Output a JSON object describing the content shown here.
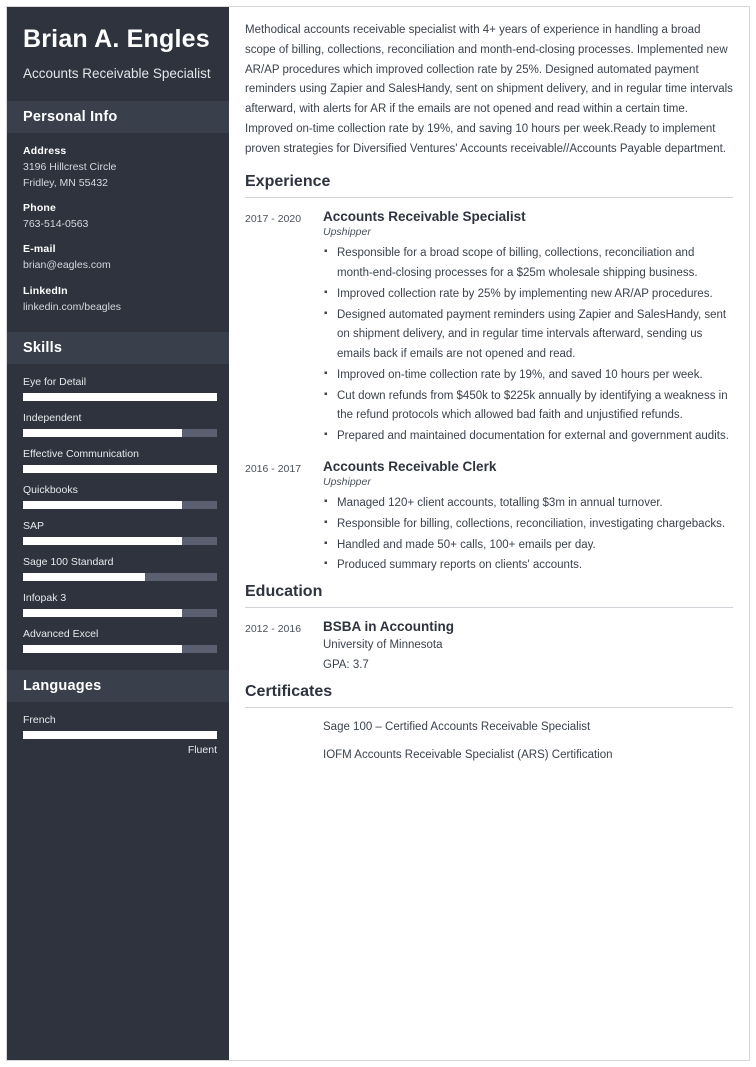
{
  "sidebar": {
    "name": "Brian A. Engles",
    "job_title": "Accounts Receivable Specialist",
    "personal_info_title": "Personal Info",
    "info": [
      {
        "label": "Address",
        "value": "3196 Hillcrest Circle",
        "value2": "Fridley, MN 55432"
      },
      {
        "label": "Phone",
        "value": "763-514-0563"
      },
      {
        "label": "E-mail",
        "value": "brian@eagles.com"
      },
      {
        "label": "LinkedIn",
        "value": "linkedin.com/beagles"
      }
    ],
    "skills_title": "Skills",
    "skills": [
      {
        "name": "Eye for Detail",
        "level": 100
      },
      {
        "name": "Independent",
        "level": 82
      },
      {
        "name": "Effective Communication",
        "level": 100
      },
      {
        "name": "Quickbooks",
        "level": 82
      },
      {
        "name": "SAP",
        "level": 82
      },
      {
        "name": "Sage 100 Standard",
        "level": 63
      },
      {
        "name": "Infopak 3",
        "level": 82
      },
      {
        "name": "Advanced Excel",
        "level": 82
      }
    ],
    "languages_title": "Languages",
    "languages": [
      {
        "name": "French",
        "level": 100,
        "proficiency": "Fluent"
      }
    ]
  },
  "main": {
    "summary": "Methodical accounts receivable specialist with 4+ years of experience in handling a broad scope of billing, collections, reconciliation and month-end-closing processes. Implemented new AR/AP procedures which improved collection rate by 25%. Designed automated payment reminders using Zapier and SalesHandy, sent on shipment delivery, and in regular time intervals afterward, with alerts for AR if the emails are not opened and read within a certain time. Improved on-time collection rate by 19%, and saving 10 hours per week.Ready to implement proven strategies for Diversified Ventures' Accounts receivable//Accounts Payable department.",
    "experience_title": "Experience",
    "experience": [
      {
        "date": "2017 - 2020",
        "title": "Accounts Receivable Specialist",
        "company": "Upshipper",
        "bullets": [
          "Responsible for a broad scope of billing, collections, reconciliation and month-end-closing processes for a $25m wholesale shipping business.",
          "Improved collection rate by 25% by implementing new AR/AP procedures.",
          "Designed automated payment reminders using Zapier and SalesHandy, sent on shipment delivery, and in regular time intervals afterward, sending us emails back if emails are not opened and read.",
          "Improved on-time collection rate by 19%, and saved 10 hours per week.",
          "Cut down refunds from $450k to $225k annually by identifying a weakness in the refund protocols which allowed bad faith and unjustified refunds.",
          "Prepared and maintained documentation for external and government audits."
        ]
      },
      {
        "date": "2016 - 2017",
        "title": "Accounts Receivable Clerk",
        "company": "Upshipper",
        "bullets": [
          "Managed 120+ client accounts, totalling $3m in annual turnover.",
          "Responsible for billing, collections, reconciliation, investigating chargebacks.",
          "Handled and made 50+ calls, 100+ emails per day.",
          "Produced summary reports on clients' accounts."
        ]
      }
    ],
    "education_title": "Education",
    "education": [
      {
        "date": "2012 - 2016",
        "title": "BSBA in Accounting",
        "school": "University of Minnesota",
        "gpa": "GPA: 3.7"
      }
    ],
    "certificates_title": "Certificates",
    "certificates": [
      "Sage 100 – Certified Accounts Receivable Specialist",
      "IOFM Accounts Receivable Specialist (ARS) Certification"
    ]
  }
}
